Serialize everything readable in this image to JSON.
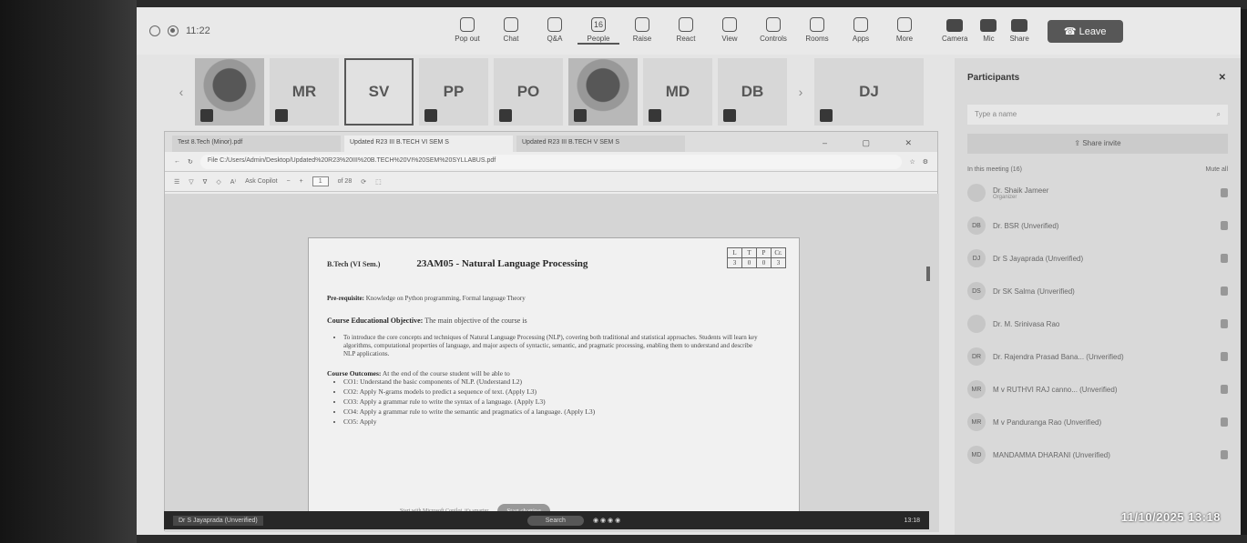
{
  "teams": {
    "time": "11:22",
    "toolbar": [
      {
        "label": "Pop out",
        "icon": "pop-out-icon"
      },
      {
        "label": "Chat",
        "icon": "chat-icon"
      },
      {
        "label": "Q&A",
        "icon": "qa-icon"
      },
      {
        "label": "People",
        "icon": "people-icon",
        "badge": "16"
      },
      {
        "label": "Raise",
        "icon": "hand-icon"
      },
      {
        "label": "React",
        "icon": "react-icon"
      },
      {
        "label": "View",
        "icon": "grid-icon"
      },
      {
        "label": "Controls",
        "icon": "controls-icon"
      },
      {
        "label": "Rooms",
        "icon": "rooms-icon"
      },
      {
        "label": "Apps",
        "icon": "apps-icon"
      },
      {
        "label": "More",
        "icon": "more-icon"
      }
    ],
    "camera": "Camera",
    "mic": "Mic",
    "share": "Share",
    "leave": "Leave"
  },
  "participants_strip": [
    "MR",
    "SV",
    "PP",
    "PO",
    "MD",
    "DB",
    "DJ"
  ],
  "browser": {
    "tabs": [
      "Test 8.Tech (Minor).pdf",
      "Updated R23 III B.TECH VI SEM S",
      "Updated R23 III B.TECH V SEM S"
    ],
    "url": "File  C:/Users/Admin/Desktop/Updated%20R23%20III%20B.TECH%20VI%20SEM%20SYLLABUS.pdf",
    "ask": "Ask Copilot",
    "page": "1",
    "of_pages": "of 28"
  },
  "pdf": {
    "semester": "B.Tech (VI Sem.)",
    "title": "23AM05 - Natural Language Processing",
    "ltp_headers": [
      "L",
      "T",
      "P",
      "Cr."
    ],
    "ltp_values": [
      "3",
      "0",
      "0",
      "3"
    ],
    "prereq_label": "Pre-requisite:",
    "prereq_text": "Knowledge on Python programming, Formal language Theory",
    "ceo_label": "Course Educational Objective:",
    "ceo_text": "The main objective of the course is",
    "ceo_bullet": "To introduce the core concepts and techniques of Natural Language Processing (NLP), covering both traditional and statistical approaches. Students will learn key algorithms, computational properties of language, and major aspects of syntactic, semantic, and pragmatic processing, enabling them to understand and describe NLP applications.",
    "co_label": "Course Outcomes:",
    "co_text": "At the end of the course student will be able to",
    "outcomes": [
      "CO1: Understand the basic components of NLP. (Understand L2)",
      "CO2: Apply N-grams models to predict a sequence of text. (Apply L3)",
      "CO3: Apply a grammar rule to write the syntax of a language. (Apply L3)",
      "CO4: Apply a grammar rule to write the semantic and pragmatics of a language. (Apply L3)",
      "CO5: Apply"
    ],
    "find_text": "Start with Microsoft Copilot, it's smarter",
    "find_button": "Start chatting"
  },
  "taskbar": {
    "presenter": "Dr S Jayaprada (Unverified)",
    "search": "Search",
    "clock": "13:18"
  },
  "panel": {
    "title": "Participants",
    "search_placeholder": "Type a name",
    "share_invite": "Share invite",
    "in_meeting": "In this meeting (16)",
    "mute_all": "Mute all",
    "people": [
      {
        "initials": "",
        "name": "Dr. Shaik Jameer",
        "role": "Organizer"
      },
      {
        "initials": "DB",
        "name": "Dr. BSR (Unverified)",
        "role": ""
      },
      {
        "initials": "DJ",
        "name": "Dr S Jayaprada (Unverified)",
        "role": ""
      },
      {
        "initials": "DS",
        "name": "Dr SK Salma (Unverified)",
        "role": ""
      },
      {
        "initials": "",
        "name": "Dr. M. Srinivasa Rao",
        "role": ""
      },
      {
        "initials": "DR",
        "name": "Dr. Rajendra Prasad Bana... (Unverified)",
        "role": ""
      },
      {
        "initials": "MR",
        "name": "M v RUTHVI RAJ canno... (Unverified)",
        "role": ""
      },
      {
        "initials": "MR",
        "name": "M v Panduranga Rao (Unverified)",
        "role": ""
      },
      {
        "initials": "MD",
        "name": "MANDAMMA DHARANI (Unverified)",
        "role": ""
      }
    ]
  },
  "photo_timestamp": "11/10/2025 13:18"
}
